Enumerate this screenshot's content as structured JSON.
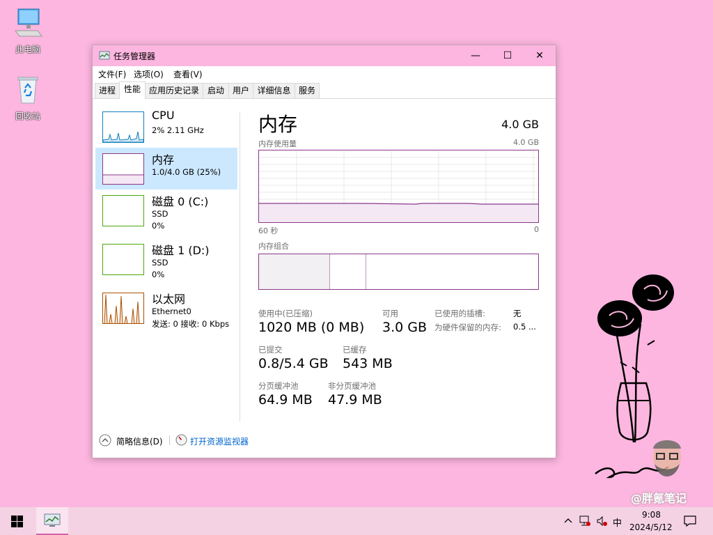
{
  "desktop": {
    "icons": [
      {
        "label": "此电脑"
      },
      {
        "label": "回收站"
      }
    ],
    "watermark": "@胖氪笔记"
  },
  "window": {
    "title": "任务管理器",
    "menu": [
      "文件(F)",
      "选项(O)",
      "查看(V)"
    ],
    "tabs": [
      "进程",
      "性能",
      "应用历史记录",
      "启动",
      "用户",
      "详细信息",
      "服务"
    ],
    "active_tab": "性能",
    "sidebar": [
      {
        "name": "CPU",
        "line1": "2%  2.11 GHz",
        "line2": ""
      },
      {
        "name": "内存",
        "line1": "1.0/4.0 GB (25%)",
        "line2": ""
      },
      {
        "name": "磁盘 0 (C:)",
        "line1": "SSD",
        "line2": "0%"
      },
      {
        "name": "磁盘 1 (D:)",
        "line1": "SSD",
        "line2": "0%"
      },
      {
        "name": "以太网",
        "line1": "Ethernet0",
        "line2": "发送: 0  接收: 0 Kbps"
      }
    ],
    "main": {
      "title": "内存",
      "total": "4.0 GB",
      "usage_label": "内存使用量",
      "usage_max": "4.0 GB",
      "time_left": "60 秒",
      "time_right": "0",
      "composition_label": "内存组合",
      "stats": {
        "in_use_label": "使用中(已压缩)",
        "in_use_value": "1020 MB (0 MB)",
        "available_label": "可用",
        "available_value": "3.0 GB",
        "slots_label": "已使用的插槽:",
        "slots_value": "无",
        "reserved_label": "为硬件保留的内存:",
        "reserved_value": "0.5 ...",
        "committed_label": "已提交",
        "committed_value": "0.8/5.4 GB",
        "cached_label": "已缓存",
        "cached_value": "543 MB",
        "paged_label": "分页缓冲池",
        "paged_value": "64.9 MB",
        "nonpaged_label": "非分页缓冲池",
        "nonpaged_value": "47.9 MB"
      }
    },
    "footer": {
      "brief": "简略信息(D)",
      "monitor": "打开资源监视器"
    }
  },
  "taskbar": {
    "ime": "中",
    "time": "9:08",
    "date": "2024/5/12"
  },
  "colors": {
    "desktop_bg": "#fcb6df",
    "memory": "#8b378b",
    "cpu": "#117dbb",
    "disk": "#4da60c",
    "ethernet": "#a74f01",
    "selection": "#cce8ff"
  }
}
